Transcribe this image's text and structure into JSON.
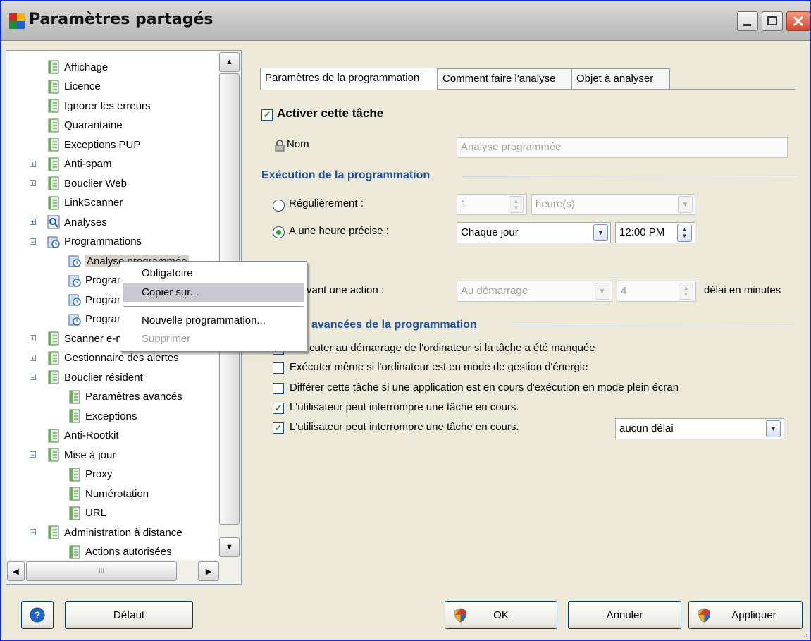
{
  "window": {
    "title": "Paramètres partagés"
  },
  "tree": {
    "items": [
      {
        "label": "Affichage",
        "indent": 1,
        "icon": "doc",
        "expander": ""
      },
      {
        "label": "Licence",
        "indent": 1,
        "icon": "doc",
        "expander": ""
      },
      {
        "label": "Ignorer les erreurs",
        "indent": 1,
        "icon": "doc",
        "expander": ""
      },
      {
        "label": "Quarantaine",
        "indent": 1,
        "icon": "doc",
        "expander": ""
      },
      {
        "label": "Exceptions PUP",
        "indent": 1,
        "icon": "doc",
        "expander": ""
      },
      {
        "label": "Anti-spam",
        "indent": 1,
        "icon": "doc",
        "expander": "+"
      },
      {
        "label": "Bouclier Web",
        "indent": 1,
        "icon": "doc",
        "expander": "+"
      },
      {
        "label": "LinkScanner",
        "indent": 1,
        "icon": "doc",
        "expander": ""
      },
      {
        "label": "Analyses",
        "indent": 1,
        "icon": "scan",
        "expander": "+"
      },
      {
        "label": "Programmations",
        "indent": 1,
        "icon": "sched",
        "expander": "-"
      },
      {
        "label": "Analyse programmée",
        "indent": 2,
        "icon": "sched",
        "expander": "",
        "selected": true
      },
      {
        "label": "Programmation de la mise à jour des définitions",
        "indent": 2,
        "icon": "sched",
        "expander": ""
      },
      {
        "label": "Programmation de la mise à jour du programme",
        "indent": 2,
        "icon": "sched",
        "expander": ""
      },
      {
        "label": "Programmation de la mise à jour anti-spam",
        "indent": 2,
        "icon": "sched",
        "expander": ""
      },
      {
        "label": "Scanner e-mail",
        "indent": 1,
        "icon": "doc",
        "expander": "+"
      },
      {
        "label": "Gestionnaire des alertes",
        "indent": 1,
        "icon": "doc",
        "expander": "+"
      },
      {
        "label": "Bouclier résident",
        "indent": 1,
        "icon": "doc",
        "expander": "-"
      },
      {
        "label": "Paramètres avancés",
        "indent": 2,
        "icon": "doc",
        "expander": ""
      },
      {
        "label": "Exceptions",
        "indent": 2,
        "icon": "doc",
        "expander": ""
      },
      {
        "label": "Anti-Rootkit",
        "indent": 1,
        "icon": "doc",
        "expander": ""
      },
      {
        "label": "Mise à jour",
        "indent": 1,
        "icon": "doc",
        "expander": "-"
      },
      {
        "label": "Proxy",
        "indent": 2,
        "icon": "doc",
        "expander": ""
      },
      {
        "label": "Numérotation",
        "indent": 2,
        "icon": "doc",
        "expander": ""
      },
      {
        "label": "URL",
        "indent": 2,
        "icon": "doc",
        "expander": ""
      },
      {
        "label": "Administration à distance",
        "indent": 1,
        "icon": "doc",
        "expander": "-"
      },
      {
        "label": "Actions autorisées",
        "indent": 2,
        "icon": "doc",
        "expander": ""
      }
    ]
  },
  "context_menu": {
    "items": [
      "Obligatoire",
      "Copier sur...",
      "Nouvelle programmation...",
      "Supprimer"
    ]
  },
  "tabs": [
    "Paramètres de la programmation",
    "Comment faire l'analyse",
    "Objet à analyser"
  ],
  "form": {
    "enable_task": "Activer cette tâche",
    "name_label": "Nom",
    "name_value": "Analyse programmée",
    "section_execution": "Exécution de la programmation",
    "regular_label": "Régulièrement :",
    "regular_value": "1",
    "regular_unit": "heure(s)",
    "specific_label": "A une heure précise :",
    "specific_freq": "Chaque jour",
    "specific_time": "12:00 PM",
    "action_label": "vant une action :",
    "action_value": "Au démarrage",
    "delay_value": "4",
    "delay_label": "délai en minutes",
    "section_advanced": "avancées de la programmation",
    "opt1": "cuter au démarrage de l'ordinateur si la tâche a été manquée",
    "opt2": "Exécuter même si l'ordinateur est en mode de gestion d'énergie",
    "opt3": "Différer cette tâche si une application est en cours d'exécution en mode plein écran",
    "opt4": "L'utilisateur peut interrompre une tâche en cours.",
    "opt5": "L'utilisateur peut interrompre une tâche en cours.",
    "delay_select": "aucun délai"
  },
  "buttons": {
    "default": "Défaut",
    "ok": "OK",
    "cancel": "Annuler",
    "apply": "Appliquer"
  },
  "scroll_glyphs": {
    "up": "▲",
    "down": "▼",
    "left": "◀",
    "right": "▶",
    "grip": "III",
    "dropdown": "▼",
    "spin_up": "▲",
    "spin_down": "▼",
    "check": "✓"
  },
  "colors": {
    "section": "#1f4f9c",
    "window_border": "#0831d9",
    "title_bg": "#c9c9c9"
  }
}
